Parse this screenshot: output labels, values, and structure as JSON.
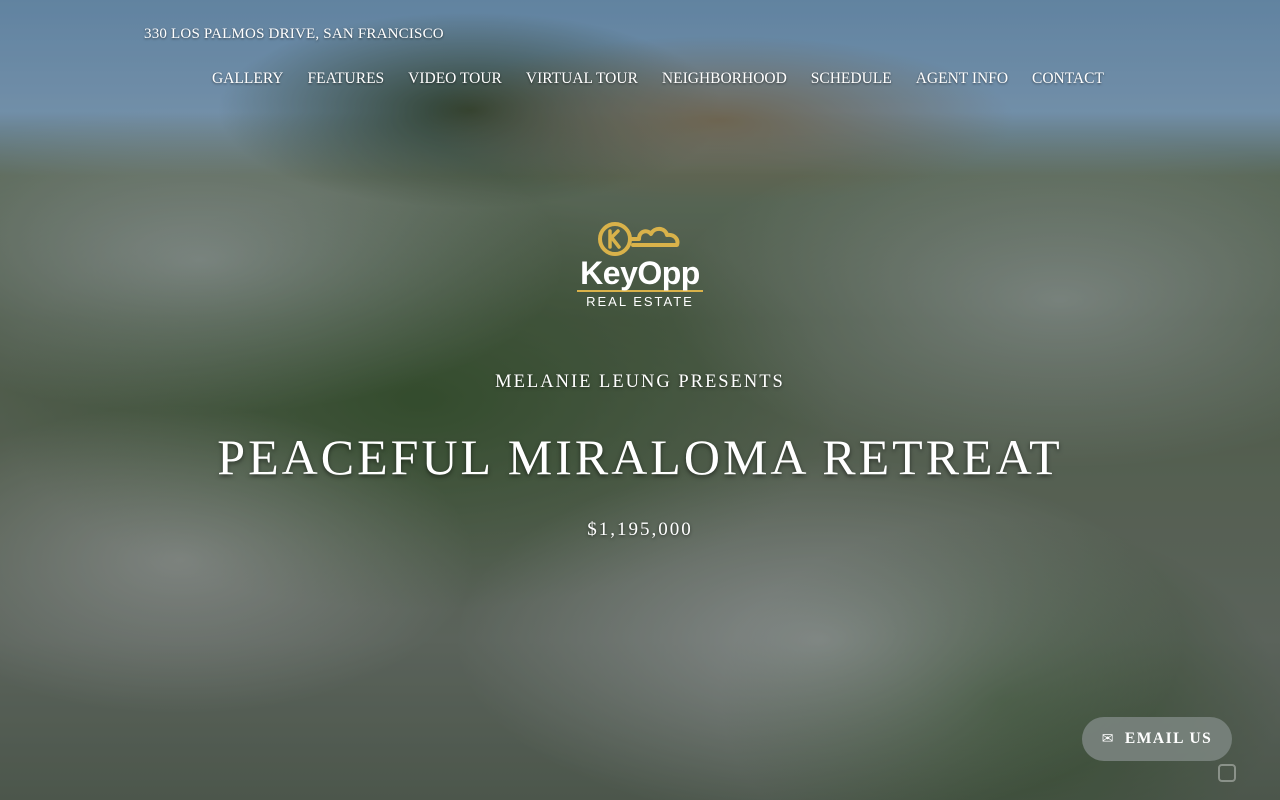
{
  "header": {
    "address": "330 LOS PALMOS DRIVE, SAN FRANCISCO"
  },
  "nav": {
    "items": [
      {
        "label": "GALLERY"
      },
      {
        "label": "FEATURES"
      },
      {
        "label": "VIDEO TOUR"
      },
      {
        "label": "VIRTUAL TOUR"
      },
      {
        "label": "NEIGHBORHOOD"
      },
      {
        "label": "SCHEDULE"
      },
      {
        "label": "AGENT INFO"
      },
      {
        "label": "CONTACT"
      }
    ]
  },
  "logo": {
    "wordmark": "KeyOpp",
    "tagline": "REAL ESTATE",
    "icon": "key-cloud-logo-icon",
    "accent_color": "#d9b24a"
  },
  "hero": {
    "presenter": "MELANIE LEUNG PRESENTS",
    "title": "PEACEFUL MIRALOMA RETREAT",
    "price": "$1,195,000"
  },
  "contact_button": {
    "label": "EMAIL US",
    "icon": "envelope-icon",
    "background": "#78827d"
  }
}
